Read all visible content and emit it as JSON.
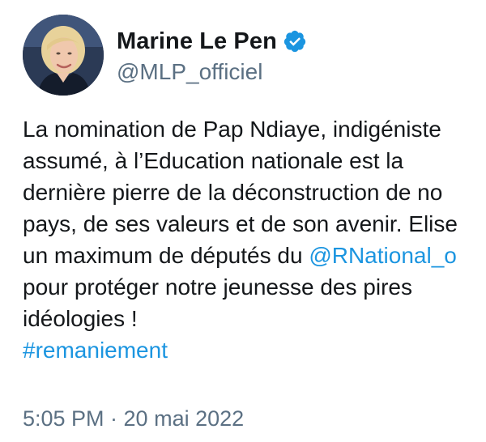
{
  "colors": {
    "link": "#1b95e0",
    "secondary_text": "#5b7083",
    "primary_text": "#14171a",
    "verified_badge": "#1b95e0"
  },
  "author": {
    "display_name": "Marine Le Pen",
    "handle": "@MLP_officiel",
    "verified_icon": "verified-badge-icon",
    "avatar_icon": "profile-photo"
  },
  "tweet": {
    "lines": {
      "l1": "La nomination de Pap Ndiaye, indigéniste",
      "l2": "assumé, à l’Education nationale est la",
      "l3": "dernière pierre de la déconstruction de no",
      "l4": "pays, de ses valeurs et de son avenir. Elise",
      "l5_text": "un maximum de députés du ",
      "l5_mention": "@RNational_o",
      "l6": "pour protéger notre jeunesse des pires",
      "l7": "idéologies !"
    },
    "hashtag": "#remaniement",
    "timestamp": "5:05 PM · 20 mai 2022"
  }
}
